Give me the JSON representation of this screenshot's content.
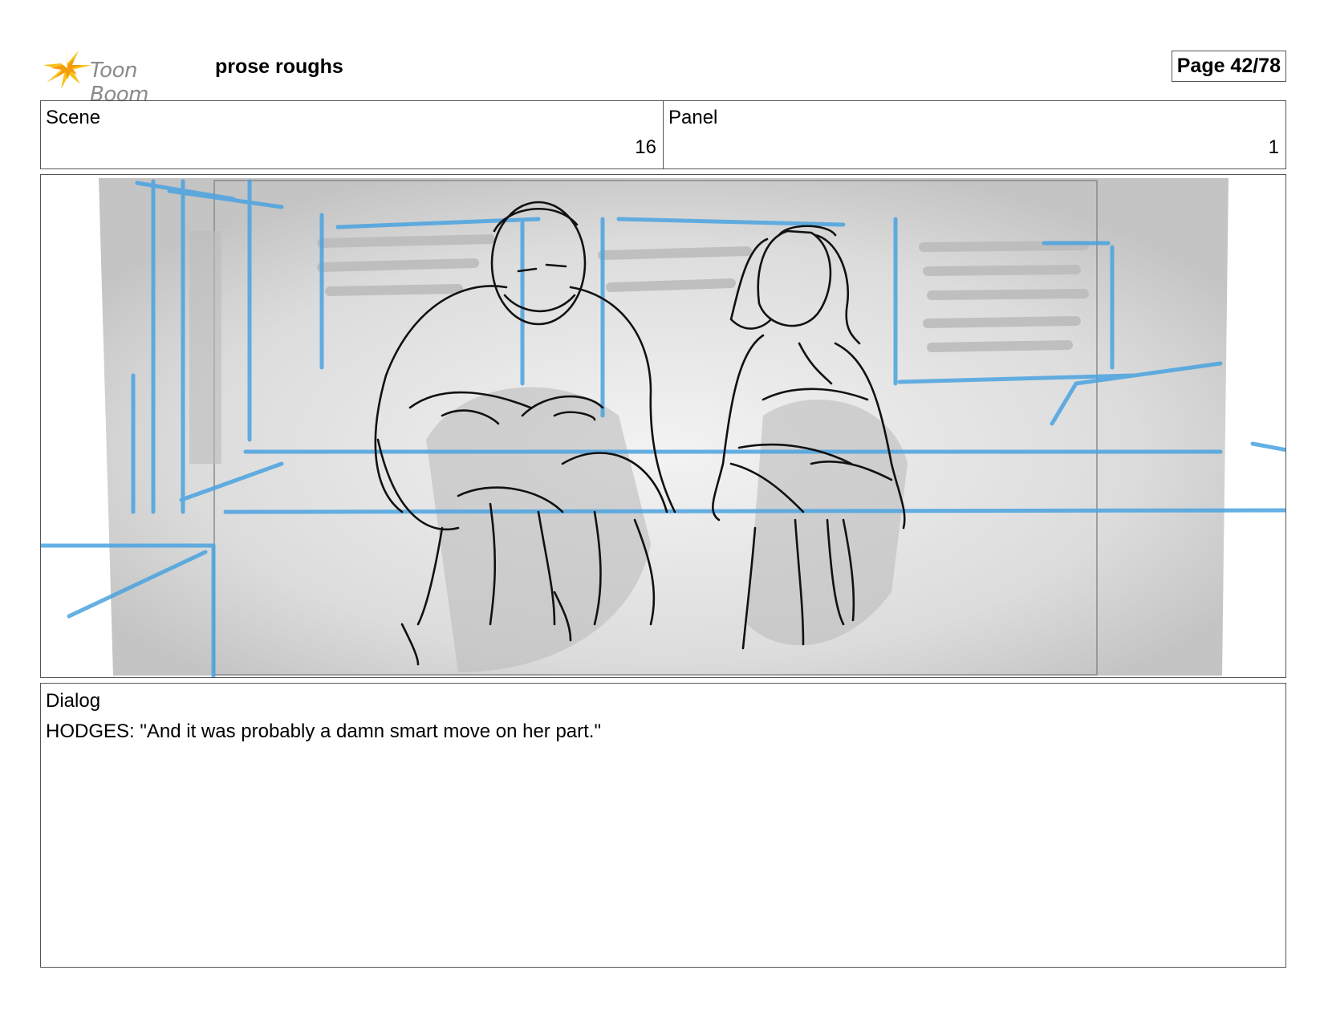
{
  "header": {
    "logo_text": "Toon Boom",
    "title": "prose roughs",
    "page_label": "Page 42/78"
  },
  "scene": {
    "label": "Scene",
    "value": "16"
  },
  "panel": {
    "label": "Panel",
    "value": "1"
  },
  "dialog": {
    "label": "Dialog",
    "text": "HODGES: \"And it was probably a damn smart move on her part.\""
  },
  "colors": {
    "guide_blue": "#4aa3e0",
    "sketch_black": "#111111",
    "background_gray": "#d6d6d6"
  }
}
